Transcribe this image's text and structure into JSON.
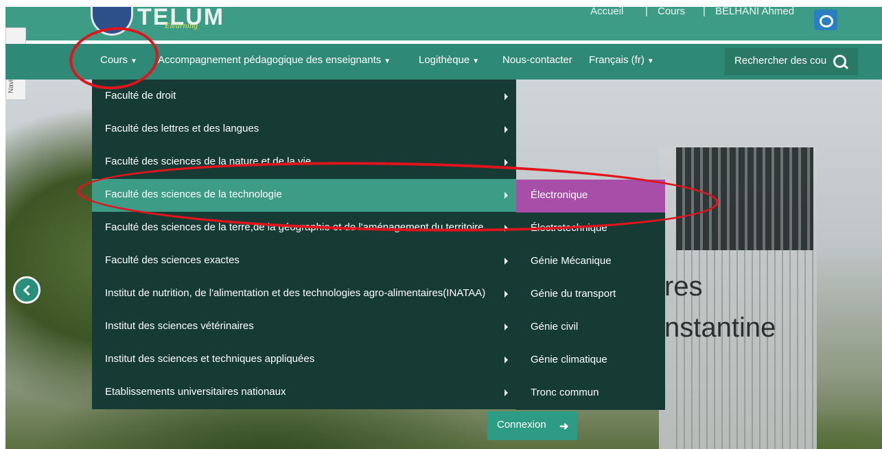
{
  "site": {
    "logo_text": "TELUM",
    "logo_subtitle": "Elearning"
  },
  "top_links": {
    "home": "Accueil",
    "courses": "Cours",
    "user_name": "BELHANI Ahmed"
  },
  "side_tab": {
    "label": "Navigation"
  },
  "nav": {
    "items": [
      {
        "label": "Cours"
      },
      {
        "label": "Accompagnement pédagogique des enseignants"
      },
      {
        "label": "Logithèque"
      },
      {
        "label": "Nous-contacter"
      },
      {
        "label": "Français (fr)"
      }
    ],
    "search_placeholder": "Rechercher des cou"
  },
  "menu": {
    "items": [
      {
        "label": "Faculté de droit"
      },
      {
        "label": "Faculté des lettres et des langues"
      },
      {
        "label": "Faculté des sciences de la nature et de la vie"
      },
      {
        "label": "Faculté des sciences de la technologie"
      },
      {
        "label": "Faculté des sciences de la terre,de la géographie et de l'aménagement du territoire"
      },
      {
        "label": "Faculté des sciences exactes"
      },
      {
        "label": "Institut de nutrition, de l'alimentation et des technologies agro-alimentaires(INATAA)"
      },
      {
        "label": "Institut des sciences vétérinaires"
      },
      {
        "label": "Institut des sciences et techniques appliquées"
      },
      {
        "label": "Etablissements universitaires nationaux"
      }
    ],
    "active_index": 3
  },
  "submenu": {
    "items": [
      {
        "label": "Électronique"
      },
      {
        "label": "Électrotechnique"
      },
      {
        "label": "Génie Mécanique"
      },
      {
        "label": "Génie du transport"
      },
      {
        "label": "Génie civil"
      },
      {
        "label": "Génie climatique"
      },
      {
        "label": "Tronc commun"
      }
    ],
    "active_index": 0
  },
  "hero": {
    "line1": "res",
    "line2": "nstantine"
  },
  "login_button": {
    "label": "Connexion"
  },
  "colors": {
    "topbar": "#3d9c86",
    "navbar": "#2e8a76",
    "menu_bg": "#163b34",
    "menu_active": "#3d9c86",
    "submenu_active": "#a74ea8",
    "annotation": "#e0141c"
  }
}
